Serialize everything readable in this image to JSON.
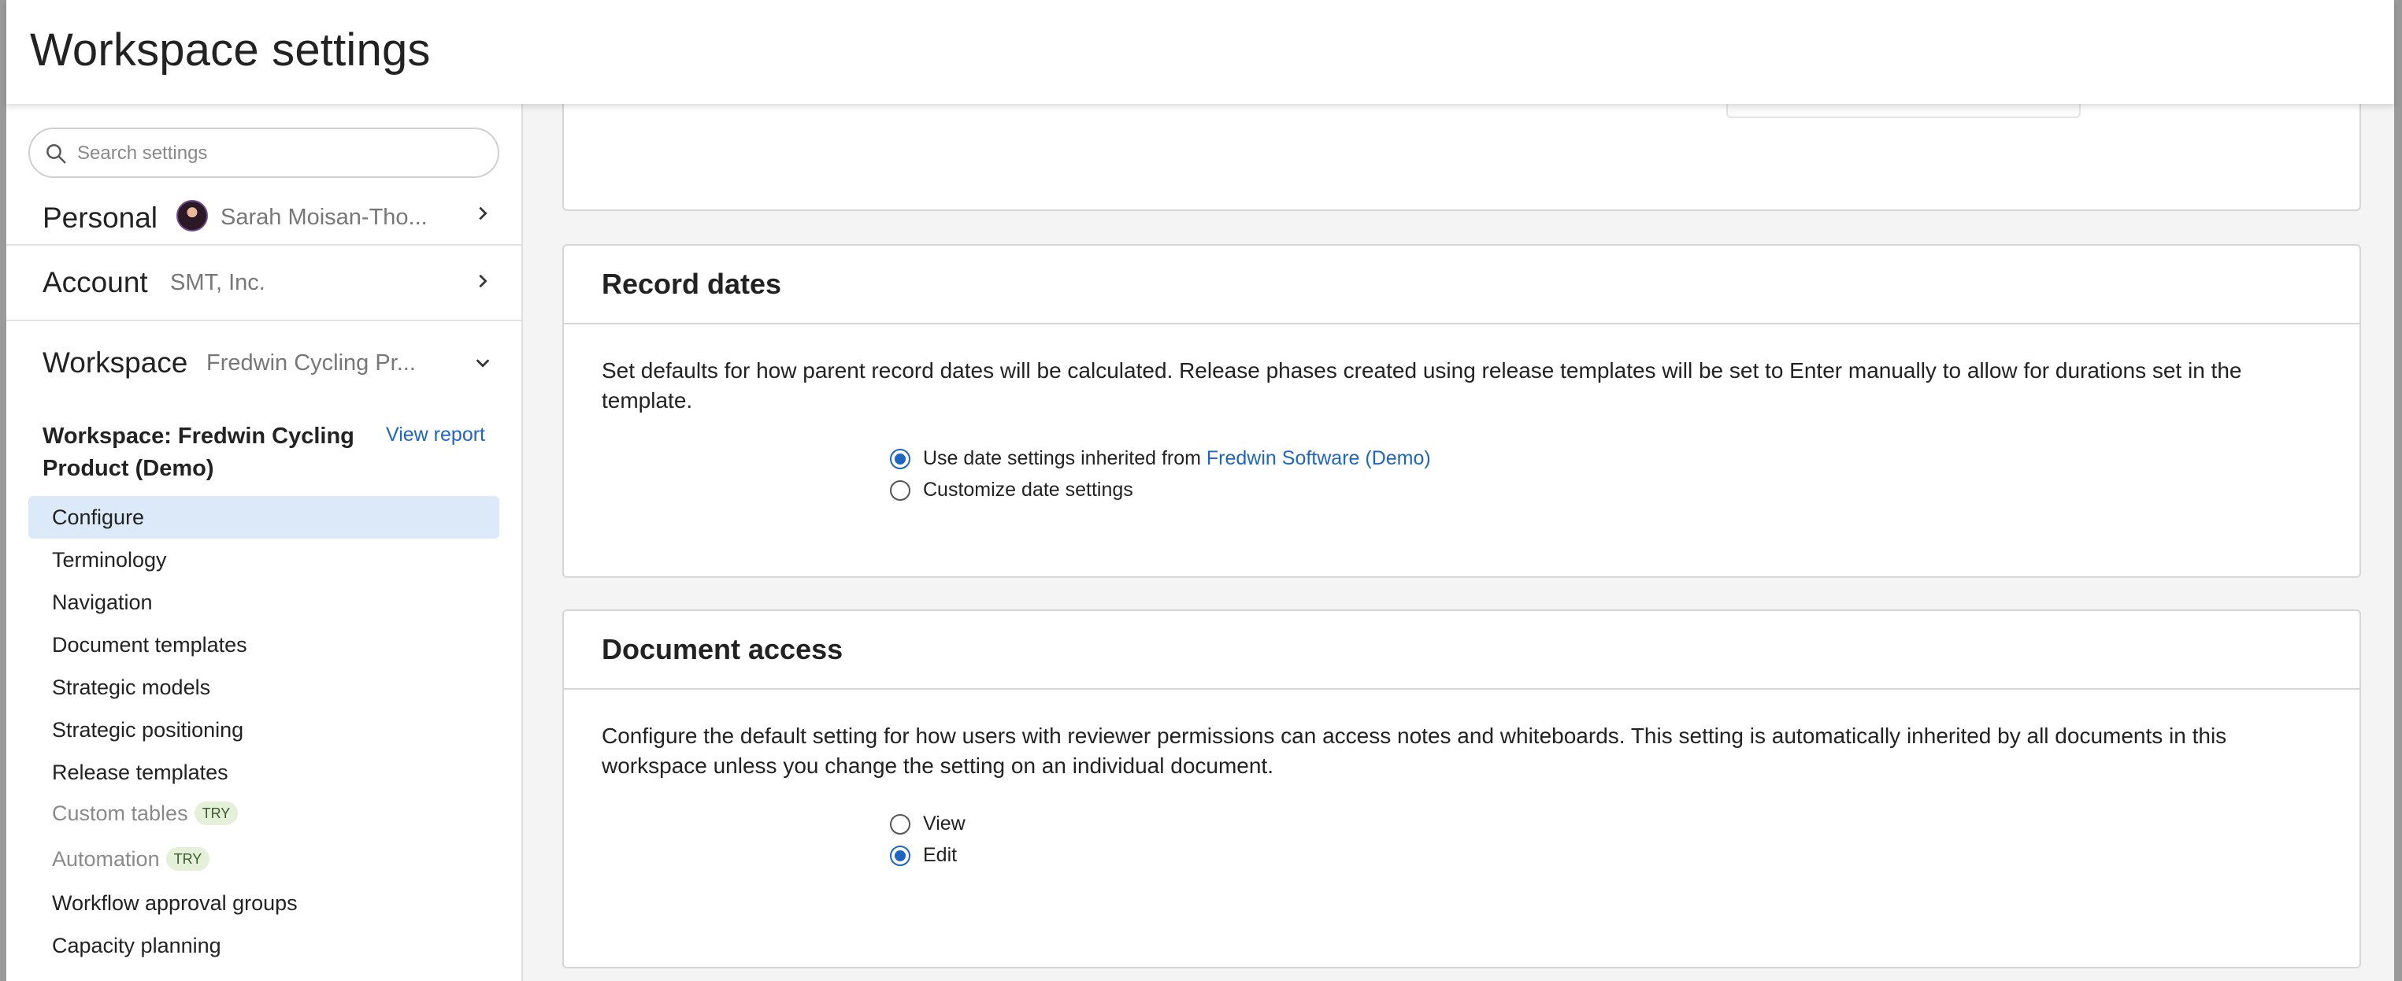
{
  "header": {
    "title": "Workspace settings"
  },
  "search": {
    "placeholder": "Search settings"
  },
  "sections": {
    "personal": {
      "title": "Personal",
      "subtitle": "Sarah Moisan-Tho..."
    },
    "account": {
      "title": "Account",
      "subtitle": "SMT, Inc."
    },
    "workspace": {
      "title": "Workspace",
      "subtitle": "Fredwin Cycling Pr..."
    }
  },
  "workspace_panel": {
    "heading": "Workspace: Fredwin Cycling Product (Demo)",
    "view_report": "View report"
  },
  "nav": [
    {
      "label": "Configure",
      "active": true
    },
    {
      "label": "Terminology"
    },
    {
      "label": "Navigation"
    },
    {
      "label": "Document templates"
    },
    {
      "label": "Strategic models"
    },
    {
      "label": "Strategic positioning"
    },
    {
      "label": "Release templates"
    },
    {
      "label": "Custom tables",
      "badge": "TRY",
      "muted": true
    },
    {
      "label": "Automation",
      "badge": "TRY",
      "muted": true
    },
    {
      "label": "Workflow approval groups"
    },
    {
      "label": "Capacity planning"
    }
  ],
  "record_dates": {
    "title": "Record dates",
    "description": "Set defaults for how parent record dates will be calculated. Release phases created using release templates will be set to Enter manually to allow for durations set in the template.",
    "option_inherited_prefix": "Use date settings inherited from ",
    "option_inherited_link": "Fredwin Software (Demo)",
    "option_customize": "Customize date settings",
    "selected": "inherited"
  },
  "document_access": {
    "title": "Document access",
    "description": "Configure the default setting for how users with reviewer permissions can access notes and whiteboards. This setting is automatically inherited by all documents in this workspace unless you change the setting on an individual document.",
    "option_view": "View",
    "option_edit": "Edit",
    "selected": "edit"
  }
}
